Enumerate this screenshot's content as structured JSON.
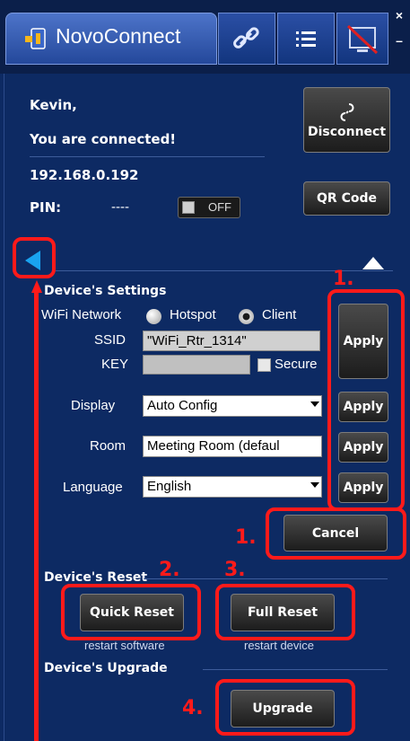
{
  "app": {
    "title_prefix": "Novo",
    "title_suffix": "Connect"
  },
  "winctl": {
    "close": "×",
    "minimize": "–"
  },
  "connection": {
    "greeting": "Kevin,",
    "status": "You are connected!",
    "ip": "192.168.0.192",
    "pin_label": "PIN:",
    "pin_value": "----",
    "toggle_label": "OFF",
    "disconnect_label": "Disconnect",
    "qr_label": "QR Code"
  },
  "settings": {
    "heading": "Device's Settings",
    "wifi_label": "WiFi Network",
    "hotspot_label": "Hotspot",
    "client_label": "Client",
    "ssid_label": "SSID",
    "ssid_value": "\"WiFi_Rtr_1314\"",
    "key_label": "KEY",
    "key_value": "",
    "secure_label": "Secure",
    "display_label": "Display",
    "display_value": "Auto Config",
    "room_label": "Room",
    "room_value": "Meeting Room (defaul",
    "language_label": "Language",
    "language_value": "English",
    "apply_label": "Apply",
    "cancel_label": "Cancel"
  },
  "reset": {
    "heading": "Device's Reset",
    "quick_label": "Quick Reset",
    "quick_caption": "restart software",
    "full_label": "Full Reset",
    "full_caption": "restart device"
  },
  "upgrade": {
    "heading": "Device's Upgrade",
    "button_label": "Upgrade"
  },
  "annotations": {
    "n1a": "1.",
    "n1b": "1.",
    "n2": "2.",
    "n3": "3.",
    "n4": "4."
  },
  "colors": {
    "highlight": "#ff1a1a",
    "panel_bg": "#0d2a63",
    "button_dark": "#2a2a2a"
  }
}
